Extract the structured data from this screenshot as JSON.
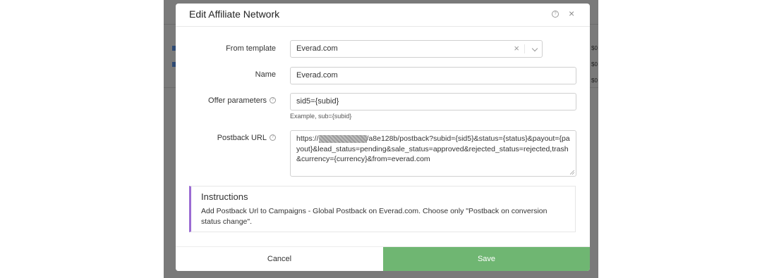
{
  "modal": {
    "title": "Edit Affiliate Network",
    "help_icon": "question-circle-icon",
    "close_icon": "close-icon",
    "close_glyph": "×",
    "help_glyph": "?"
  },
  "form": {
    "from_template": {
      "label": "From template",
      "value": "Everad.com",
      "clear_glyph": "×"
    },
    "name": {
      "label": "Name",
      "value": "Everad.com"
    },
    "offer_parameters": {
      "label": "Offer parameters",
      "value": "sid5={subid}",
      "hint": "Example, sub={subid}"
    },
    "postback_url": {
      "label": "Postback URL",
      "prefix": "https://",
      "redacted": true,
      "suffix": "/a8e128b/postback?subid={sid5}&status={status}&payout={payout}&lead_status=pending&sale_status=approved&rejected_status=rejected,trash&currency={currency}&from=everad.com"
    },
    "info_glyph": "?"
  },
  "instructions": {
    "title": "Instructions",
    "text": "Add Postback Url to Campaigns - Global Postback on Everad.com. Choose only \"Postback on conversion status change\".",
    "accent_color": "#9b6bd3"
  },
  "footer": {
    "cancel_label": "Cancel",
    "save_label": "Save",
    "save_color": "#6fb672"
  },
  "background": {
    "values": [
      "$0",
      "$0",
      "$0"
    ]
  }
}
